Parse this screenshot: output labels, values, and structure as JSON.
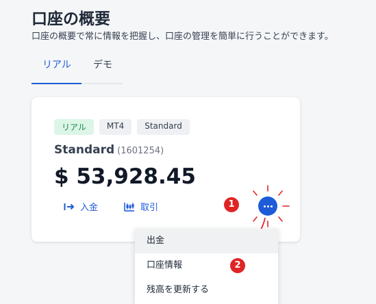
{
  "header": {
    "title": "口座の概要",
    "subtitle": "口座の概要で常に情報を把握し、口座の管理を簡単に行うことができます。"
  },
  "tabs": [
    {
      "label": "リアル",
      "active": true
    },
    {
      "label": "デモ",
      "active": false
    }
  ],
  "account_card": {
    "badges": [
      "リアル",
      "MT4",
      "Standard"
    ],
    "plan_name": "Standard",
    "account_number": "(1601254)",
    "balance": "$ 53,928.45",
    "actions": {
      "deposit_label": "入金",
      "trade_label": "取引"
    }
  },
  "dropdown_menu": {
    "items": [
      "出金",
      "口座情報",
      "残高を更新する"
    ],
    "hovered_index": 0
  },
  "annotations": {
    "step_1": "1",
    "step_2": "2"
  },
  "colors": {
    "accent": "#1e5bd8",
    "annotation_red": "#e02424",
    "live_badge_bg": "#dcf5e7",
    "live_badge_text": "#1b8a4d"
  },
  "icons": {
    "deposit": "arrow-right-bar-icon",
    "trade": "candlestick-chart-icon",
    "more": "more-horizontal-icon"
  }
}
